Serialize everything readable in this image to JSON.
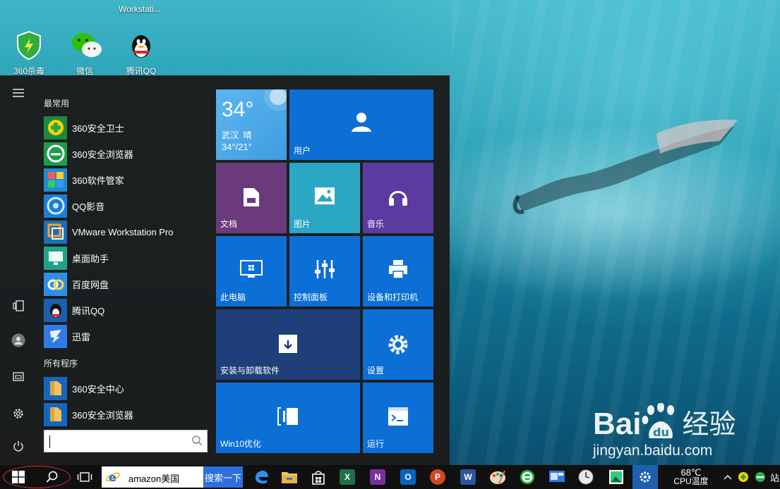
{
  "desktop": {
    "top_labels_cut": [
      "Workstati..."
    ],
    "icons": [
      {
        "label": "360杀毒",
        "icon": "shield-icon",
        "color": "#2fae3f"
      },
      {
        "label": "微信",
        "icon": "wechat-icon",
        "color": "#2dc100"
      },
      {
        "label": "腾讯QQ",
        "icon": "qq-penguin-icon",
        "color": "#111111"
      }
    ]
  },
  "start_menu": {
    "most_used_header": "最常用",
    "most_used": [
      {
        "label": "360安全卫士",
        "icon": "360-guard-icon",
        "color": "#1aa052"
      },
      {
        "label": "360安全浏览器",
        "icon": "360-browser-icon",
        "color": "#2bb24c"
      },
      {
        "label": "360软件管家",
        "icon": "360-software-icon",
        "color": "#1e8ccd"
      },
      {
        "label": "QQ影音",
        "icon": "qq-player-icon",
        "color": "#1b7fd6"
      },
      {
        "label": "VMware Workstation Pro",
        "icon": "vmware-icon",
        "color": "#1c6fb7"
      },
      {
        "label": "桌面助手",
        "icon": "desktop-assistant-icon",
        "color": "#21a38a"
      },
      {
        "label": "百度网盘",
        "icon": "baidu-netdisk-icon",
        "color": "#2f8fe8"
      },
      {
        "label": "腾讯QQ",
        "icon": "qq-penguin-icon",
        "color": "#1b5fb0"
      },
      {
        "label": "迅雷",
        "icon": "thunder-icon",
        "color": "#2f7be3"
      }
    ],
    "all_programs_header": "所有程序",
    "all_programs": [
      {
        "label": "360安全中心",
        "icon": "folder-icon",
        "color": "#f0c45c"
      },
      {
        "label": "360安全浏览器",
        "icon": "folder-icon",
        "color": "#f0c45c"
      }
    ],
    "search_placeholder": ""
  },
  "tiles": {
    "weather": {
      "temp": "34°",
      "city_condition": "武汉  晴",
      "range": "34°/21°",
      "color": "#4aa8e8"
    },
    "user": {
      "label": "用户",
      "color": "#0b6fd6"
    },
    "docs": {
      "label": "文档",
      "color": "#6b3a7d"
    },
    "pictures": {
      "label": "图片",
      "color": "#2aa8c3"
    },
    "music": {
      "label": "音乐",
      "color": "#5b3aa2"
    },
    "computer": {
      "label": "此电脑",
      "color": "#0b6fd6"
    },
    "control_panel": {
      "label": "控制面板",
      "color": "#0b6fd6"
    },
    "devices": {
      "label": "设备和打印机",
      "color": "#0b6fd6"
    },
    "uninstall": {
      "label": "安装与卸载软件",
      "color": "#1e3f7a"
    },
    "settings": {
      "label": "设置",
      "color": "#0b6fd6"
    },
    "win10opt": {
      "label": "Win10优化",
      "color": "#0b6fd6"
    },
    "run": {
      "label": "运行",
      "color": "#0b6fd6"
    }
  },
  "taskbar": {
    "search_query": "amazon美国",
    "search_button": "搜索一下",
    "temp": "68℃",
    "cpu_label": "CPU温度",
    "tray_cut": "站"
  },
  "watermark": {
    "brand": "Bai",
    "brand2": "du",
    "cn": "经验",
    "url": "jingyan.baidu.com"
  }
}
